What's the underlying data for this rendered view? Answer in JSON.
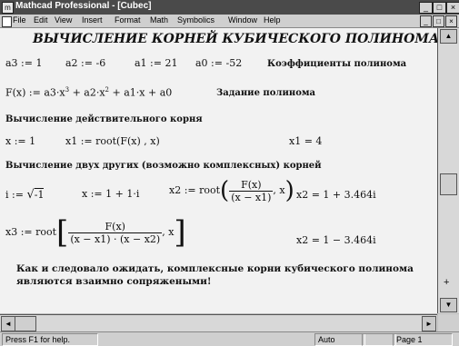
{
  "window": {
    "title": "Mathcad Professional - [Cubec]",
    "minimize_glyph": "_",
    "maximize_glyph": "□",
    "close_glyph": "×"
  },
  "menu": {
    "items": [
      "File",
      "Edit",
      "View",
      "Insert",
      "Format",
      "Math",
      "Symbolics",
      "Window",
      "Help"
    ],
    "doc_minimize_glyph": "_",
    "doc_restore_glyph": "□",
    "doc_close_glyph": "×"
  },
  "document": {
    "title": "ВЫЧИСЛЕНИЕ КОРНЕЙ КУБИЧЕСКОГО ПОЛИНОМА",
    "coefficients": [
      {
        "name": "a3",
        "value": "1"
      },
      {
        "name": "a2",
        "value": "-6"
      },
      {
        "name": "a1",
        "value": "21"
      },
      {
        "name": "a0",
        "value": "-52"
      }
    ],
    "coef_label": "Коэффициенты полинома",
    "poly_lhs": "F(x)",
    "poly_label": "Задание полинома",
    "real_root_heading": "Вычисление действительного корня",
    "x_init": "x := 1",
    "x1_def_lhs": "x1 := root(F(x) , x)",
    "x1_result": "x1 = 4",
    "complex_heading": "Вычисление двух других (возможно комплексных) корней",
    "i_def_lhs": "i := ",
    "i_def_rad": "-1",
    "x_init2": "x := 1 + 1·i",
    "x2_def_lhs": "x2 := root",
    "frac1_num": "F(x)",
    "frac1_den": "(x − x1)",
    "frac_var": ", x",
    "x2_result": "x2 = 1 + 3.464i",
    "x3_def_lhs": "x3 := root",
    "frac2_num": "F(x)",
    "frac2_den": "(x − x1) · (x − x2)",
    "x3_result": "x2 = 1 − 3.464i",
    "conclusion_line1": "Как и следовало ожидать, комплексные корни кубического полинома",
    "conclusion_line2": "являются взаимно сопряжеными!"
  },
  "scroll": {
    "up": "▲",
    "down": "▼",
    "left": "◄",
    "right": "►",
    "marker": "+"
  },
  "status": {
    "help": "Press F1 for help.",
    "mode": "Auto",
    "page": "Page 1"
  }
}
